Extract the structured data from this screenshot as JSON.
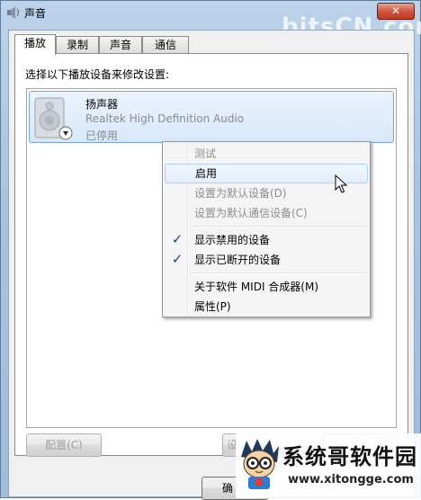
{
  "window": {
    "title": "声音",
    "close_glyph": "✕",
    "watermark_top": "bitsCN.com"
  },
  "tabs": [
    {
      "label": "播放"
    },
    {
      "label": "录制"
    },
    {
      "label": "声音"
    },
    {
      "label": "通信"
    }
  ],
  "playback": {
    "instruction": "选择以下播放设备来修改设置:",
    "device": {
      "name": "扬声器",
      "driver": "Realtek High Definition Audio",
      "status": "已停用"
    },
    "buttons": {
      "configure": "配置(C)",
      "set_default": "设",
      "ok": "确",
      "cancel": ""
    }
  },
  "context_menu": {
    "items": [
      {
        "label": "测试",
        "enabled": false,
        "checked": false
      },
      {
        "label": "启用",
        "enabled": true,
        "checked": false,
        "hover": true
      },
      {
        "label": "设置为默认设备(D)",
        "enabled": false,
        "checked": false
      },
      {
        "label": "设置为默认通信设备(C)",
        "enabled": false,
        "checked": false
      },
      {
        "label": "显示禁用的设备",
        "enabled": true,
        "checked": true
      },
      {
        "label": "显示已断开的设备",
        "enabled": true,
        "checked": true
      },
      {
        "label": "关于软件 MIDI 合成器(M)",
        "enabled": true,
        "checked": false
      },
      {
        "label": "属性(P)",
        "enabled": true,
        "checked": false
      }
    ],
    "check_glyph": "✓"
  },
  "watermark": {
    "title": "系统哥软件园",
    "url": "www.xitongge.com"
  }
}
